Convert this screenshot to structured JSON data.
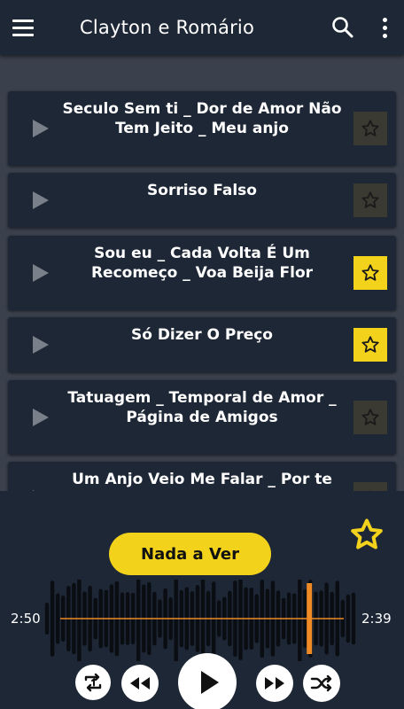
{
  "header": {
    "title": "Clayton e Romário",
    "menu_icon": "hamburger-menu-icon",
    "search_icon": "search-icon",
    "more_icon": "more-vert-icon"
  },
  "songs": [
    {
      "title": "Seculo Sem ti _ Dor de Amor Não Tem Jeito _ Meu anjo",
      "lines": [
        "Seculo Sem ti _ Dor de Amor Não",
        "Tem Jeito _ Meu anjo"
      ],
      "favorite": false
    },
    {
      "title": "Sorriso Falso",
      "lines": [
        "Sorriso Falso"
      ],
      "favorite": false
    },
    {
      "title": "Sou eu _ Cada Volta É Um Recomeço _ Voa Beija Flor",
      "lines": [
        "Sou eu _ Cada Volta É Um",
        "Recomeço _ Voa Beija Flor"
      ],
      "favorite": true
    },
    {
      "title": "Só Dizer O Preço",
      "lines": [
        "Só Dizer O Preço"
      ],
      "favorite": true
    },
    {
      "title": "Tatuagem _ Temporal de Amor _ Página de Amigos",
      "lines": [
        "Tatuagem _ Temporal de Amor _",
        "Página de Amigos"
      ],
      "favorite": false
    },
    {
      "title": "Um Anjo Veio Me Falar _ Por te",
      "lines": [
        "Um Anjo Veio Me Falar _ Por te"
      ],
      "favorite": false
    }
  ],
  "player": {
    "now_playing": "Nada a Ver",
    "elapsed": "2:50",
    "remaining": "2:39",
    "progress": 0.85,
    "favorite": false
  },
  "colors": {
    "accent": "#f3d21c",
    "background": "#1e2736",
    "list_background": "#3a404c",
    "progress_line": "#f08a24"
  },
  "controls": [
    "repeat-one-icon",
    "rewind-icon",
    "play-icon",
    "fast-forward-icon",
    "shuffle-icon"
  ]
}
